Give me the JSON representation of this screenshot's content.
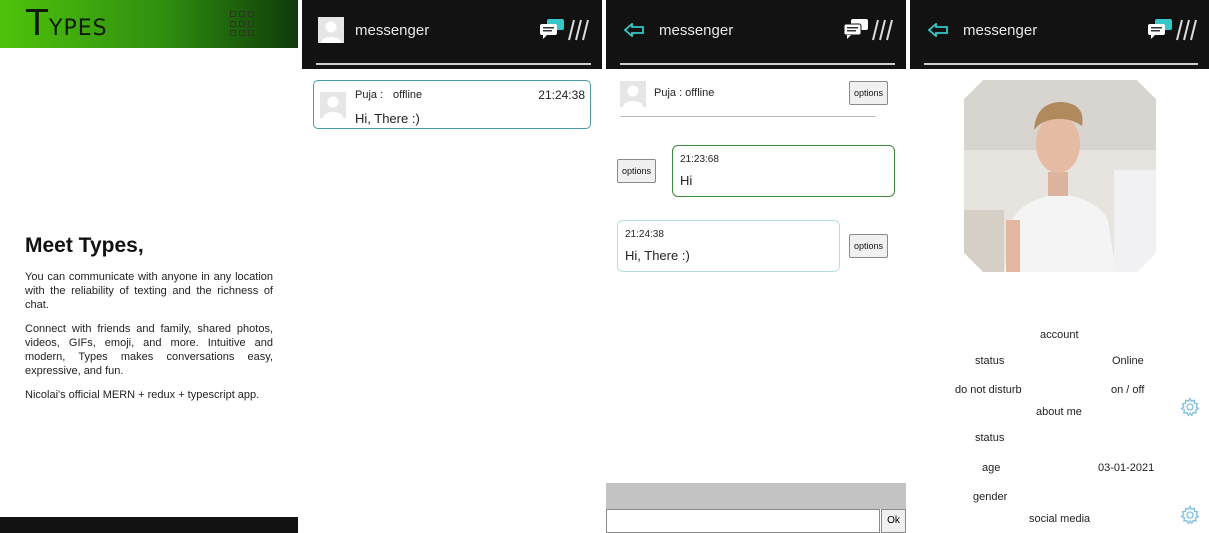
{
  "landing": {
    "logo_first": "T",
    "logo_rest": "YPES",
    "heading": "Meet Types,",
    "para1": "You can communicate with anyone in any location with the reliability of texting and the richness of chat.",
    "para2": "Connect with friends and family, shared photos, videos, GIFs, emoji, and more. Intuitive and modern, Types makes conversations easy, expressive, and fun.",
    "para3": "Nicolai's official MERN + redux + typescript app.",
    "icons": {
      "apps": "grid-icon"
    }
  },
  "header": {
    "title": "messenger",
    "icons": {
      "chat": "chat-bubbles-icon",
      "menu": "triple-slash-icon",
      "back": "back-arrow-icon"
    },
    "accent": "#35c9c9"
  },
  "conversation_list": {
    "items": [
      {
        "name": "Puja :",
        "status": "offline",
        "time": "21:24:38",
        "message": "Hi, There :)"
      }
    ]
  },
  "chat": {
    "contact": "Puja : offline",
    "options_label": "options",
    "messages": [
      {
        "direction": "out",
        "time": "21:23:68",
        "text": "Hi"
      },
      {
        "direction": "in",
        "time": "21:24:38",
        "text": "Hi, There :)"
      }
    ],
    "input_value": "",
    "send_label": "Ok"
  },
  "profile": {
    "account_label": "account",
    "status_label": "status",
    "status_value": "Online",
    "dnd_label": "do not disturb",
    "dnd_value": "on / off",
    "about_label": "about me",
    "about_status_label": "status",
    "age_label": "age",
    "age_value": "03-01-2021",
    "gender_label": "gender",
    "social_label": "social media",
    "icons": {
      "settings": "gear-icon"
    }
  },
  "colors": {
    "brand_green": "#4fc30b",
    "header_bg": "#121212",
    "teal_border": "#4b9aa8",
    "green_border": "#3a8a3a"
  }
}
